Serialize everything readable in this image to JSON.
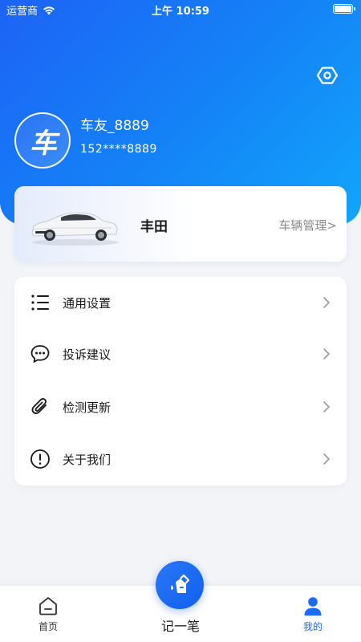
{
  "status_bar": {
    "carrier": "运营商",
    "time": "上午 10:59"
  },
  "profile": {
    "avatar_text": "车",
    "username": "车友_8889",
    "phone": "152****8889"
  },
  "car": {
    "brand": "丰田",
    "manage_label": "车辆管理>"
  },
  "menu": {
    "items": [
      {
        "label": "通用设置",
        "icon": "list-icon"
      },
      {
        "label": "投诉建议",
        "icon": "chat-icon"
      },
      {
        "label": "检测更新",
        "icon": "paperclip-icon"
      },
      {
        "label": "关于我们",
        "icon": "info-icon"
      }
    ]
  },
  "tabbar": {
    "home_label": "首页",
    "record_label": "记一笔",
    "mine_label": "我的"
  },
  "colors": {
    "accent": "#1a6cf5",
    "header_start": "#1d63f5",
    "header_end": "#12a6fb",
    "background": "#f2f4f8"
  }
}
